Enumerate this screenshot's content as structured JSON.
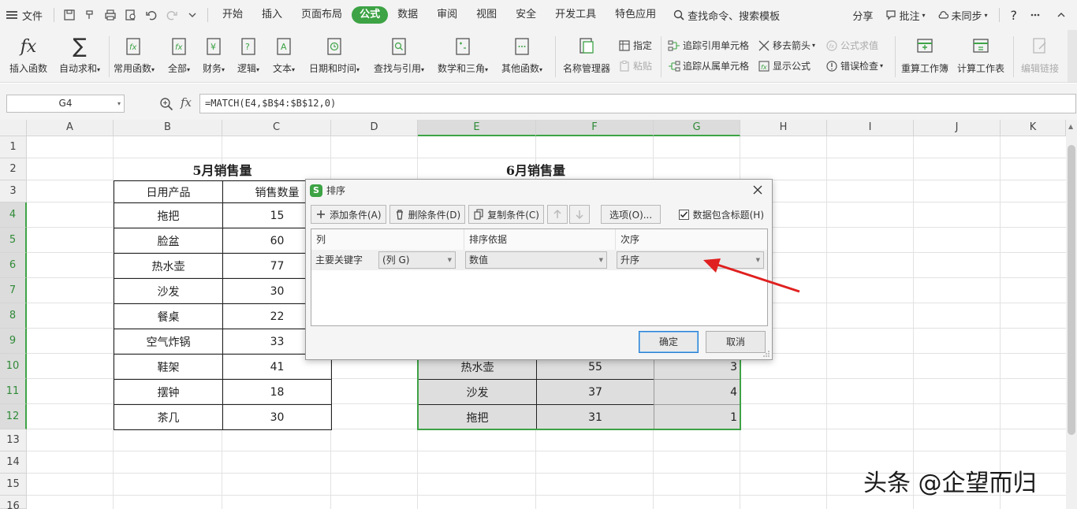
{
  "menubar": {
    "file": "文件",
    "tabs": [
      "开始",
      "插入",
      "页面布局",
      "公式",
      "数据",
      "审阅",
      "视图",
      "安全",
      "开发工具",
      "特色应用"
    ],
    "active_tab": "公式",
    "search": "查找命令、搜索模板",
    "share": "分享",
    "comment": "批注",
    "sync": "未同步",
    "help": "?"
  },
  "ribbon": {
    "insert_func": "插入函数",
    "autosum": "自动求和",
    "common": "常用函数",
    "all": "全部",
    "finance": "财务",
    "logic": "逻辑",
    "text": "文本",
    "datetime": "日期和时间",
    "lookup": "查找与引用",
    "math": "数学和三角",
    "other": "其他函数",
    "name_mgr": "名称管理器",
    "define": "指定",
    "paste": "粘贴",
    "trace_prec": "追踪引用单元格",
    "trace_dep": "追踪从属单元格",
    "remove_arrows": "移去箭头",
    "show_formula": "显示公式",
    "eval_formula": "公式求值",
    "error_check": "错误检查",
    "recalc_book": "重算工作簿",
    "calc_sheet": "计算工作表",
    "edit_links": "编辑链接"
  },
  "formula_bar": {
    "name_box": "G4",
    "fx": "fx",
    "formula": "=MATCH(E4,$B$4:$B$12,0)"
  },
  "columns": [
    "A",
    "B",
    "C",
    "D",
    "E",
    "F",
    "G",
    "H",
    "I",
    "J",
    "K"
  ],
  "rows": [
    "1",
    "2",
    "3",
    "4",
    "5",
    "6",
    "7",
    "8",
    "9",
    "10",
    "11",
    "12",
    "13",
    "14",
    "15",
    "16"
  ],
  "may_table": {
    "title": "5月销售量",
    "headers": [
      "日用产品",
      "销售数量"
    ],
    "rows": [
      [
        "拖把",
        "15"
      ],
      [
        "脸盆",
        "60"
      ],
      [
        "热水壶",
        "77"
      ],
      [
        "沙发",
        "30"
      ],
      [
        "餐桌",
        "22"
      ],
      [
        "空气炸锅",
        "33"
      ],
      [
        "鞋架",
        "41"
      ],
      [
        "摆钟",
        "18"
      ],
      [
        "茶几",
        "30"
      ]
    ]
  },
  "june_table": {
    "title": "6月销售量",
    "visible_rows": [
      [
        "热水壶",
        "55",
        "3"
      ],
      [
        "沙发",
        "37",
        "4"
      ],
      [
        "拖把",
        "31",
        "1"
      ]
    ]
  },
  "dialog": {
    "title": "排序",
    "add": "添加条件(A)",
    "delete": "删除条件(D)",
    "copy": "复制条件(C)",
    "options": "选项(O)...",
    "has_header": "数据包含标题(H)",
    "col_header": "列",
    "basis_header": "排序依据",
    "order_header": "次序",
    "primary_key": "主要关键字",
    "col_value": "(列 G)",
    "basis_value": "数值",
    "order_value": "升序",
    "ok": "确定",
    "cancel": "取消"
  },
  "watermark": "头条 @企望而归",
  "colors": {
    "accent": "#3da345",
    "arrow": "#e02020"
  }
}
